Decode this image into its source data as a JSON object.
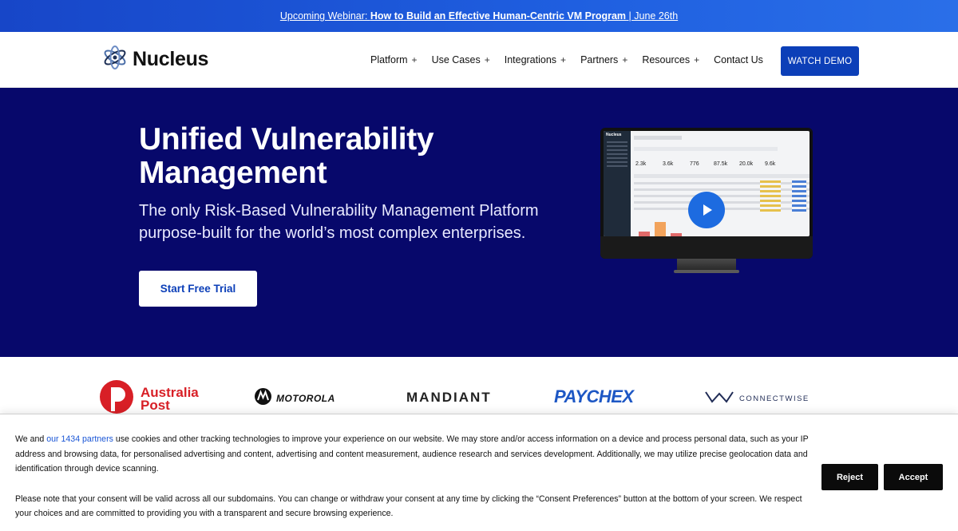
{
  "announcement": {
    "prefix": "Upcoming Webinar: ",
    "title": "How to Build an Effective Human-Centric VM Program",
    "suffix": " | June 26th"
  },
  "nav": {
    "brand": "Nucleus",
    "items": [
      {
        "label": "Platform",
        "has_submenu": true
      },
      {
        "label": "Use Cases",
        "has_submenu": true
      },
      {
        "label": "Integrations",
        "has_submenu": true
      },
      {
        "label": "Partners",
        "has_submenu": true
      },
      {
        "label": "Resources",
        "has_submenu": true
      },
      {
        "label": "Contact Us",
        "has_submenu": false
      }
    ],
    "submenu_symbol": "+",
    "cta": "WATCH DEMO"
  },
  "hero": {
    "title": "Unified Vulnerability Management",
    "subtitle": "The only Risk-Based Vulnerability Management Platform purpose-built for the world’s most complex enterprises.",
    "cta": "Start Free Trial",
    "video": {
      "brand": "Nucleus",
      "stats": [
        "2.3k",
        "3.6k",
        "776",
        "87.5k",
        "20.0k",
        "9.6k"
      ]
    }
  },
  "customers": {
    "australia_post": "Australia Post",
    "australia_post_lines": [
      "Australia",
      "Post"
    ],
    "motorola": "MOTOROLA",
    "mandiant": "MANDIANT",
    "paychex": "PAYCHEX",
    "connectwise": "CONNECTWISE"
  },
  "consent": {
    "p1_before": "We and ",
    "p1_link": "our 1434 partners",
    "p1_after": " use cookies and other tracking technologies to improve your experience on our website. We may store and/or access information on a device and process personal data, such as your IP address and browsing data, for personalised advertising and content, advertising and content measurement, audience research and services development. Additionally, we may utilize precise geolocation data and identification through device scanning.",
    "p2": "Please note that your consent will be valid across all our subdomains. You can change or withdraw your consent at any time by clicking the “Consent Preferences” button at the bottom of your screen. We respect your choices and are committed to providing you with a transparent and secure browsing experience.",
    "reject": "Reject",
    "accept": "Accept"
  },
  "colors": {
    "announcement_bg": "#1f5fe0",
    "hero_bg": "#07086b",
    "primary_blue": "#0c3fb8",
    "australia_post_red": "#d81f26",
    "paychex_blue": "#1d57c4"
  }
}
